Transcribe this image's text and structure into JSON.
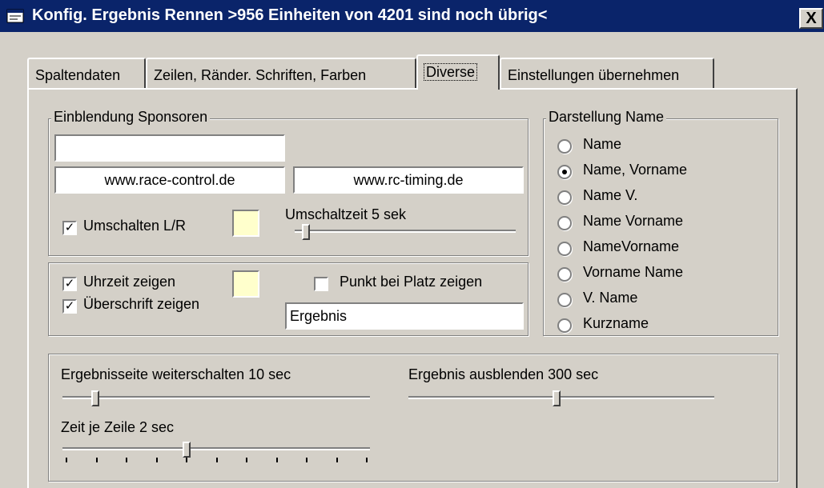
{
  "window": {
    "title": "Konfig. Ergebnis Rennen >956 Einheiten von 4201 sind noch übrig<",
    "close_label": "X"
  },
  "tabs": [
    {
      "label": "Spaltendaten",
      "active": false
    },
    {
      "label": "Zeilen, Ränder. Schriften, Farben",
      "active": false
    },
    {
      "label": "Diverse",
      "active": true
    },
    {
      "label": "Einstellungen übernehmen",
      "active": false
    }
  ],
  "sponsors": {
    "group_label": "Einblendung Sponsoren",
    "field_top": "",
    "field_left": "www.race-control.de",
    "field_right": "www.rc-timing.de",
    "toggle_lr_label": "Umschalten L/R",
    "toggle_lr_checked": true,
    "switch_time_label": "Umschaltzeit 5 sek",
    "switch_time_level": 0.08,
    "swatch_color": "#ffffcc"
  },
  "display": {
    "clock_label": "Uhrzeit zeigen",
    "clock_checked": true,
    "heading_label": "Überschrift zeigen",
    "heading_checked": true,
    "dot_label": "Punkt bei Platz zeigen",
    "dot_checked": false,
    "heading_value": "Ergebnis",
    "swatch_color": "#ffffcc"
  },
  "name_format": {
    "group_label": "Darstellung Name",
    "options": [
      {
        "label": "Name",
        "selected": false
      },
      {
        "label": "Name, Vorname",
        "selected": true
      },
      {
        "label": "Name V.",
        "selected": false
      },
      {
        "label": "Name Vorname",
        "selected": false
      },
      {
        "label": "NameVorname",
        "selected": false
      },
      {
        "label": "Vorname Name",
        "selected": false
      },
      {
        "label": "V. Name",
        "selected": false
      },
      {
        "label": "Kurzname",
        "selected": false
      }
    ]
  },
  "timing": {
    "page_advance_label": "Ergebnisseite weiterschalten  10 sec",
    "page_advance_level": 0.1,
    "hide_result_label": "Ergebnis ausblenden   300 sec",
    "hide_result_level": 0.5,
    "line_time_label": "Zeit je Zeile  2 sec",
    "line_time_level": 0.4
  }
}
